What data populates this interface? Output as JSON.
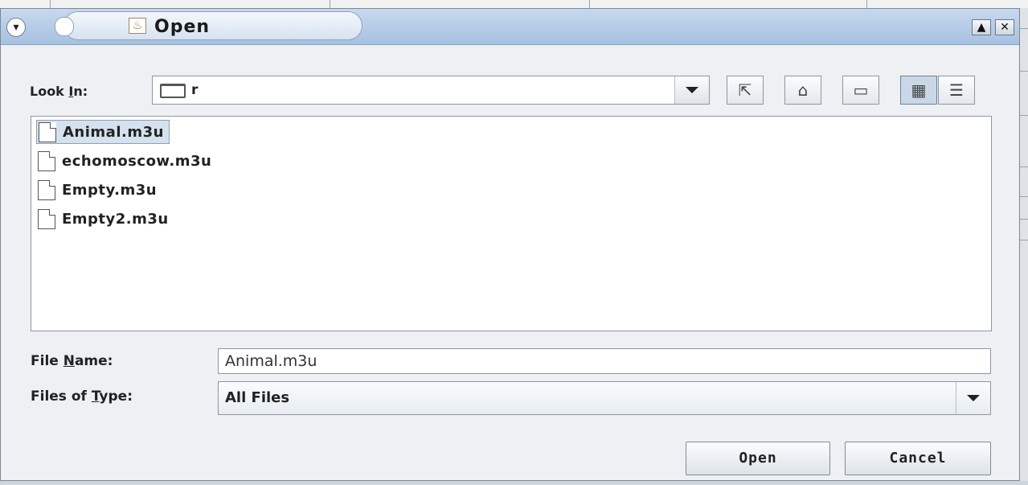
{
  "window": {
    "title": "Open",
    "menu_icon": "window-menu-icon",
    "app_icon": "java-cup-icon",
    "buttons": [
      {
        "name": "maximize-icon",
        "glyph": "▲"
      },
      {
        "name": "close-icon",
        "glyph": "✕"
      }
    ]
  },
  "look_in": {
    "label_pre": "Look ",
    "label_mnemonic": "I",
    "label_post": "n:",
    "value": "r",
    "folder_icon": "folder-icon"
  },
  "toolbar": [
    {
      "name": "up-folder-icon",
      "glyph": "⇱"
    },
    {
      "name": "home-icon",
      "glyph": "⌂"
    },
    {
      "name": "new-folder-icon",
      "glyph": "▭"
    },
    {
      "name": "list-view-icon",
      "glyph": "▦",
      "pressed": true
    },
    {
      "name": "details-view-icon",
      "glyph": "☰"
    }
  ],
  "files": [
    {
      "name": "Animal.m3u",
      "selected": true
    },
    {
      "name": "echomoscow.m3u",
      "selected": false
    },
    {
      "name": "Empty.m3u",
      "selected": false
    },
    {
      "name": "Empty2.m3u",
      "selected": false
    }
  ],
  "file_name": {
    "label_pre": "File ",
    "label_mnemonic": "N",
    "label_post": "ame:",
    "value": "Animal.m3u"
  },
  "file_type": {
    "label_pre": "Files of ",
    "label_mnemonic": "T",
    "label_post": "ype:",
    "value": "All Files"
  },
  "actions": {
    "open_label": "Open",
    "cancel_label": "Cancel"
  },
  "colors": {
    "titlebar": "#a6c1e1",
    "selection": "#d6e1ee",
    "dialog_bg": "#eef0f3"
  }
}
